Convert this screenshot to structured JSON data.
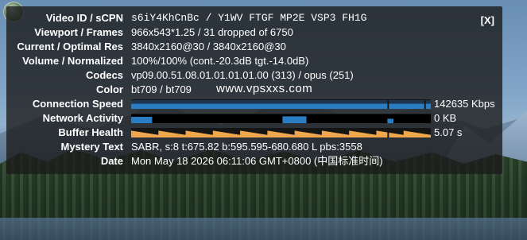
{
  "panel": {
    "close_label": "[X]",
    "rows": [
      {
        "label": "Video ID / sCPN",
        "value": "s6iY4KhCnBc / Y1WV FTGF MP2E VSP3 FH1G"
      },
      {
        "label": "Viewport / Frames",
        "value": "966x543*1.25 / 31 dropped of 6750"
      },
      {
        "label": "Current / Optimal Res",
        "value": "3840x2160@30 / 3840x2160@30"
      },
      {
        "label": "Volume / Normalized",
        "value": "100%/100% (cont.-20.3dB tgt.-14.0dB)"
      },
      {
        "label": "Codecs",
        "value": "vp09.00.51.08.01.01.01.01.00 (313) / opus (251)"
      },
      {
        "label": "Color",
        "value": "bt709 / bt709"
      },
      {
        "label": "Connection Speed",
        "value": "142635 Kbps"
      },
      {
        "label": "Network Activity",
        "value": "0 KB"
      },
      {
        "label": "Buffer Health",
        "value": "5.07 s"
      },
      {
        "label": "Mystery Text",
        "value": "SABR, s:8 t:675.82 b:595.595-680.680 L pbs:3558"
      },
      {
        "label": "Date",
        "value": "Mon May 18 2026 06:11:06 GMT+0800 (中国标准时间)"
      }
    ]
  },
  "watermark": "www.vpsxxs.com",
  "graph_data": {
    "connection_speed": {
      "color": "#2a7dc2",
      "level": 0.62,
      "dividers": [
        0.855,
        0.978
      ]
    },
    "network_activity": {
      "color": "#2a7dc2",
      "spikes": [
        [
          0.0,
          0.07,
          0.75
        ],
        [
          0.505,
          0.585,
          0.8
        ],
        [
          0.855,
          0.875,
          0.55
        ]
      ]
    },
    "buffer_health": {
      "color": "#f0a64c",
      "cycle_count": 11,
      "divider": 0.855
    }
  }
}
